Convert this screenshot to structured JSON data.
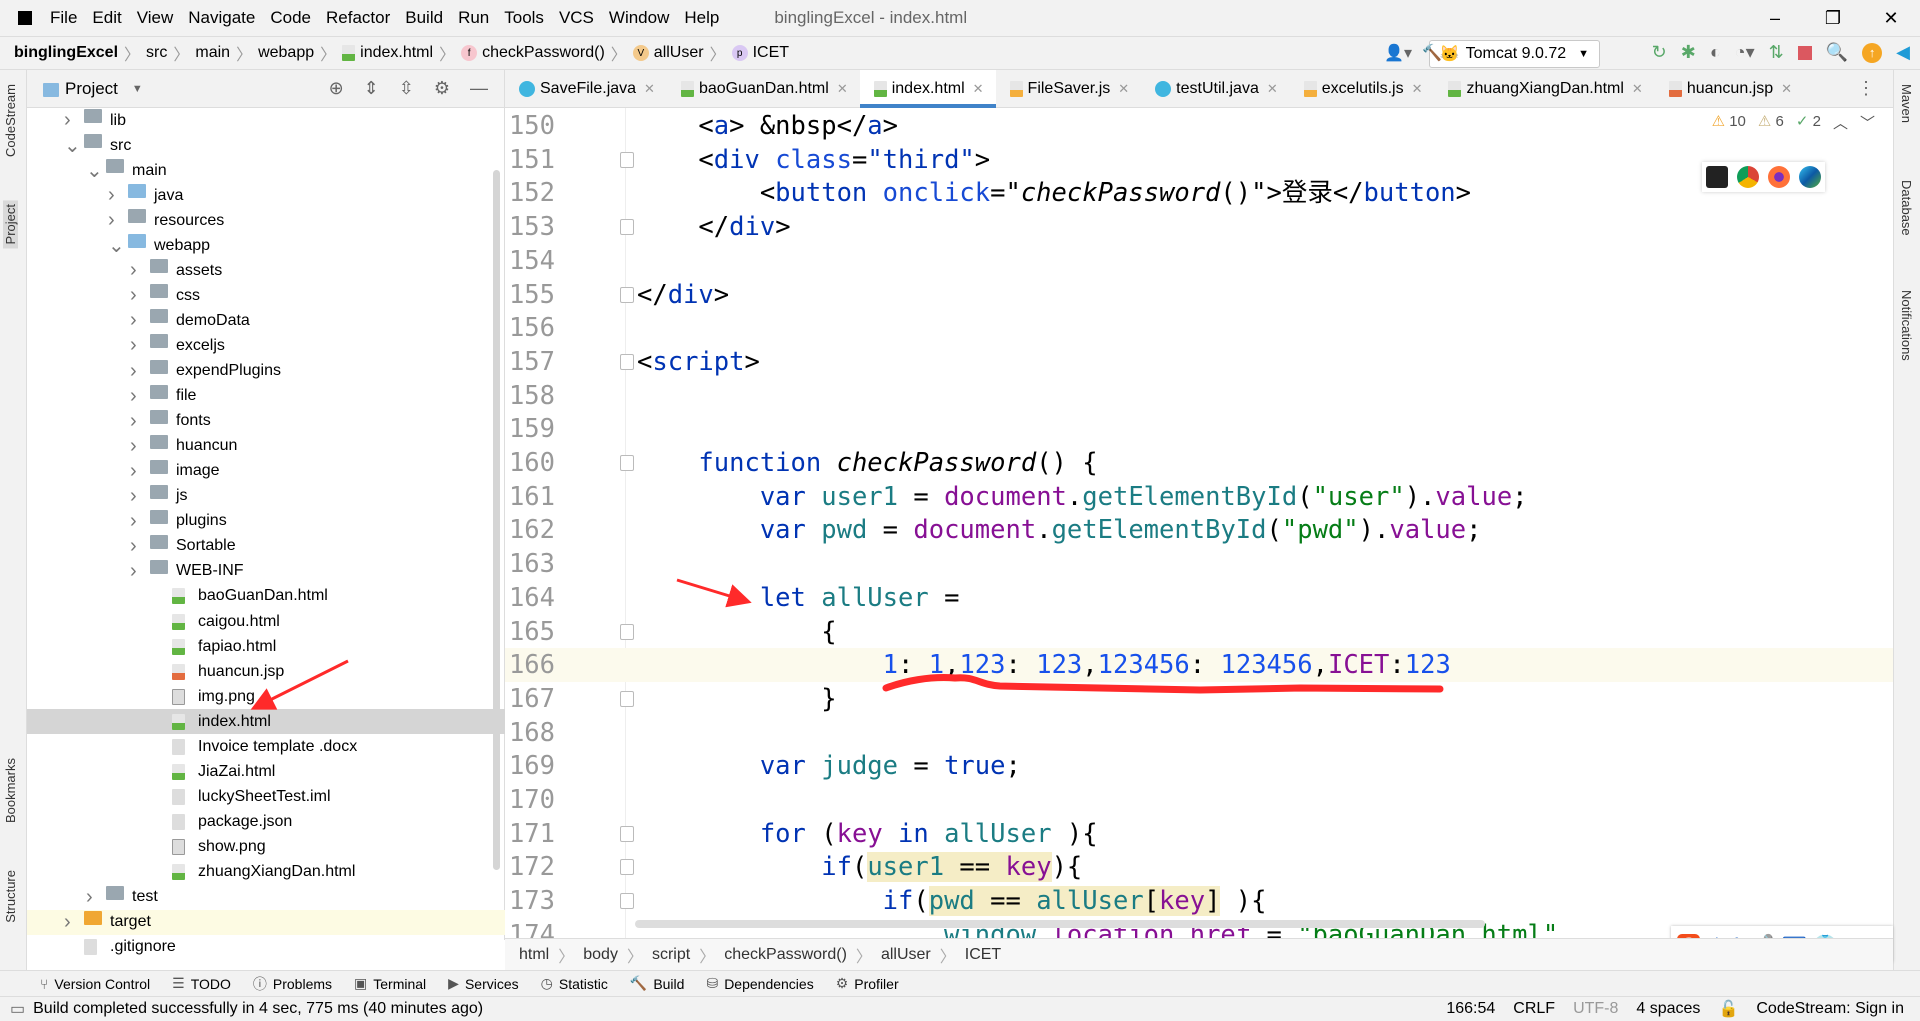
{
  "window": {
    "title": "binglingExcel - index.html",
    "controls": [
      "–",
      "❐",
      "✕"
    ]
  },
  "menu": [
    "File",
    "Edit",
    "View",
    "Navigate",
    "Code",
    "Refactor",
    "Build",
    "Run",
    "Tools",
    "VCS",
    "Window",
    "Help"
  ],
  "navbar": {
    "crumbs": [
      {
        "label": "binglingExcel",
        "icon": ""
      },
      {
        "label": "src",
        "icon": ""
      },
      {
        "label": "main",
        "icon": ""
      },
      {
        "label": "webapp",
        "icon": ""
      },
      {
        "label": "index.html",
        "icon": "html-file-icon"
      },
      {
        "label": "checkPassword()",
        "icon": "f"
      },
      {
        "label": "allUser",
        "icon": "V"
      },
      {
        "label": "ICET",
        "icon": "p"
      }
    ],
    "run_config": "Tomcat 9.0.72"
  },
  "project_panel": {
    "title": "Project",
    "tree": [
      {
        "label": "lib",
        "level": 1,
        "type": "folder",
        "arrow": "▶"
      },
      {
        "label": "src",
        "level": 1,
        "type": "folder",
        "arrow": "▼"
      },
      {
        "label": "main",
        "level": 2,
        "type": "folder",
        "arrow": "▼"
      },
      {
        "label": "java",
        "level": 3,
        "type": "folder-blue",
        "arrow": "▶"
      },
      {
        "label": "resources",
        "level": 3,
        "type": "folder",
        "arrow": "▶"
      },
      {
        "label": "webapp",
        "level": 3,
        "type": "folder-blue",
        "arrow": "▼"
      },
      {
        "label": "assets",
        "level": 4,
        "type": "folder",
        "arrow": "▶"
      },
      {
        "label": "css",
        "level": 4,
        "type": "folder",
        "arrow": "▶"
      },
      {
        "label": "demoData",
        "level": 4,
        "type": "folder",
        "arrow": "▶"
      },
      {
        "label": "exceljs",
        "level": 4,
        "type": "folder",
        "arrow": "▶"
      },
      {
        "label": "expendPlugins",
        "level": 4,
        "type": "folder",
        "arrow": "▶"
      },
      {
        "label": "file",
        "level": 4,
        "type": "folder",
        "arrow": "▶"
      },
      {
        "label": "fonts",
        "level": 4,
        "type": "folder",
        "arrow": "▶"
      },
      {
        "label": "huancun",
        "level": 4,
        "type": "folder",
        "arrow": "▶"
      },
      {
        "label": "image",
        "level": 4,
        "type": "folder",
        "arrow": "▶"
      },
      {
        "label": "js",
        "level": 4,
        "type": "folder",
        "arrow": "▶"
      },
      {
        "label": "plugins",
        "level": 4,
        "type": "folder",
        "arrow": "▶"
      },
      {
        "label": "Sortable",
        "level": 4,
        "type": "folder",
        "arrow": "▶"
      },
      {
        "label": "WEB-INF",
        "level": 4,
        "type": "folder",
        "arrow": "▶"
      },
      {
        "label": "baoGuanDan.html",
        "level": 5,
        "type": "h",
        "arrow": ""
      },
      {
        "label": "caigou.html",
        "level": 5,
        "type": "h",
        "arrow": ""
      },
      {
        "label": "fapiao.html",
        "level": 5,
        "type": "h",
        "arrow": ""
      },
      {
        "label": "huancun.jsp",
        "level": 5,
        "type": "jsp",
        "arrow": ""
      },
      {
        "label": "img.png",
        "level": 5,
        "type": "img",
        "arrow": ""
      },
      {
        "label": "index.html",
        "level": 5,
        "type": "h",
        "arrow": "",
        "selected": true
      },
      {
        "label": "Invoice template .docx",
        "level": 5,
        "type": "doc",
        "arrow": ""
      },
      {
        "label": "JiaZai.html",
        "level": 5,
        "type": "h",
        "arrow": ""
      },
      {
        "label": "luckySheetTest.iml",
        "level": 5,
        "type": "doc",
        "arrow": ""
      },
      {
        "label": "package.json",
        "level": 5,
        "type": "doc",
        "arrow": ""
      },
      {
        "label": "show.png",
        "level": 5,
        "type": "img",
        "arrow": ""
      },
      {
        "label": "zhuangXiangDan.html",
        "level": 5,
        "type": "h",
        "arrow": ""
      },
      {
        "label": "test",
        "level": 2,
        "type": "folder",
        "arrow": "▶"
      },
      {
        "label": "target",
        "level": 1,
        "type": "folder-orange",
        "arrow": "▶",
        "excluded": true
      },
      {
        "label": ".gitignore",
        "level": 1,
        "type": "doc",
        "arrow": ""
      }
    ]
  },
  "tabs": [
    {
      "label": "SaveFile.java",
      "icon": "c"
    },
    {
      "label": "baoGuanDan.html",
      "icon": "h"
    },
    {
      "label": "index.html",
      "icon": "h",
      "active": true
    },
    {
      "label": "FileSaver.js",
      "icon": "js"
    },
    {
      "label": "testUtil.java",
      "icon": "c"
    },
    {
      "label": "excelutils.js",
      "icon": "js"
    },
    {
      "label": "zhuangXiangDan.html",
      "icon": "h"
    },
    {
      "label": "huancun.jsp",
      "icon": "jsp"
    }
  ],
  "inspections": {
    "warnings": "10",
    "weak_warnings": "6",
    "typos": "2"
  },
  "editor": {
    "current_line": 166,
    "lines": [
      {
        "n": "150",
        "fold": false,
        "tokens": [
          [
            "p",
            "    <"
          ],
          [
            "tg",
            "a"
          ],
          [
            "p",
            "> &nbsp</"
          ],
          [
            "tg",
            "a"
          ],
          [
            "p",
            ">"
          ]
        ]
      },
      {
        "n": "151",
        "fold": true,
        "tokens": [
          [
            "p",
            "    <"
          ],
          [
            "tg",
            "div "
          ],
          [
            "at",
            "class"
          ],
          [
            "p",
            "="
          ],
          [
            "av",
            "\"third\""
          ],
          [
            "p",
            ">"
          ]
        ]
      },
      {
        "n": "152",
        "fold": false,
        "tokens": [
          [
            "p",
            "        <"
          ],
          [
            "tg",
            "button "
          ],
          [
            "at",
            "onclick"
          ],
          [
            "p",
            "=\""
          ],
          [
            "fn",
            "checkPassword"
          ],
          [
            "p",
            "()\">登录</"
          ],
          [
            "tg",
            "button"
          ],
          [
            "p",
            ">"
          ]
        ]
      },
      {
        "n": "153",
        "fold": true,
        "tokens": [
          [
            "p",
            "    </"
          ],
          [
            "tg",
            "div"
          ],
          [
            "p",
            ">"
          ]
        ]
      },
      {
        "n": "154",
        "fold": false,
        "tokens": []
      },
      {
        "n": "155",
        "fold": true,
        "tokens": [
          [
            "p",
            "</"
          ],
          [
            "tg",
            "div"
          ],
          [
            "p",
            ">"
          ]
        ]
      },
      {
        "n": "156",
        "fold": false,
        "tokens": []
      },
      {
        "n": "157",
        "fold": true,
        "tokens": [
          [
            "p",
            "<"
          ],
          [
            "tg",
            "script"
          ],
          [
            "p",
            ">"
          ]
        ]
      },
      {
        "n": "158",
        "fold": false,
        "tokens": []
      },
      {
        "n": "159",
        "fold": false,
        "tokens": []
      },
      {
        "n": "160",
        "fold": true,
        "tokens": [
          [
            "p",
            "    "
          ],
          [
            "k",
            "function "
          ],
          [
            "fn",
            "checkPassword"
          ],
          [
            "p",
            "() {"
          ]
        ]
      },
      {
        "n": "161",
        "fold": false,
        "tokens": [
          [
            "p",
            "        "
          ],
          [
            "k",
            "var "
          ],
          [
            "v",
            "user1"
          ],
          [
            "p",
            " = "
          ],
          [
            "g",
            "document"
          ],
          [
            "p",
            "."
          ],
          [
            "m",
            "getElementById"
          ],
          [
            "p",
            "("
          ],
          [
            "s",
            "\"user\""
          ],
          [
            "p",
            ")."
          ],
          [
            "pr",
            "value"
          ],
          [
            "p",
            ";"
          ]
        ]
      },
      {
        "n": "162",
        "fold": false,
        "tokens": [
          [
            "p",
            "        "
          ],
          [
            "k",
            "var "
          ],
          [
            "v",
            "pwd"
          ],
          [
            "p",
            " = "
          ],
          [
            "g",
            "document"
          ],
          [
            "p",
            "."
          ],
          [
            "m",
            "getElementById"
          ],
          [
            "p",
            "("
          ],
          [
            "s",
            "\"pwd\""
          ],
          [
            "p",
            ")."
          ],
          [
            "pr",
            "value"
          ],
          [
            "p",
            ";"
          ]
        ]
      },
      {
        "n": "163",
        "fold": false,
        "tokens": []
      },
      {
        "n": "164",
        "fold": false,
        "tokens": [
          [
            "p",
            "        "
          ],
          [
            "k",
            "let "
          ],
          [
            "v",
            "allUser"
          ],
          [
            "p",
            " ="
          ]
        ]
      },
      {
        "n": "165",
        "fold": true,
        "tokens": [
          [
            "p",
            "            {"
          ]
        ]
      },
      {
        "n": "166",
        "fold": false,
        "tokens": [
          [
            "p",
            "                "
          ],
          [
            "n",
            "1"
          ],
          [
            "p",
            ": "
          ],
          [
            "n",
            "1"
          ],
          [
            "p",
            ","
          ],
          [
            "n",
            "123"
          ],
          [
            "p",
            ": "
          ],
          [
            "n",
            "123"
          ],
          [
            "p",
            ","
          ],
          [
            "n",
            "123456"
          ],
          [
            "p",
            ": "
          ],
          [
            "n",
            "123456"
          ],
          [
            "p",
            ","
          ],
          [
            "pr",
            "ICET"
          ],
          [
            "p",
            ":"
          ],
          [
            "n",
            "123"
          ]
        ]
      },
      {
        "n": "167",
        "fold": true,
        "tokens": [
          [
            "p",
            "            }"
          ]
        ]
      },
      {
        "n": "168",
        "fold": false,
        "tokens": []
      },
      {
        "n": "169",
        "fold": false,
        "tokens": [
          [
            "p",
            "        "
          ],
          [
            "k",
            "var "
          ],
          [
            "v",
            "judge"
          ],
          [
            "p",
            " = "
          ],
          [
            "k",
            "true"
          ],
          [
            "p",
            ";"
          ]
        ]
      },
      {
        "n": "170",
        "fold": false,
        "tokens": []
      },
      {
        "n": "171",
        "fold": true,
        "tokens": [
          [
            "p",
            "        "
          ],
          [
            "k",
            "for "
          ],
          [
            "p",
            "("
          ],
          [
            "pr",
            "key"
          ],
          [
            "p",
            " "
          ],
          [
            "k",
            "in "
          ],
          [
            "v",
            "allUser"
          ],
          [
            "p",
            " ){"
          ]
        ]
      },
      {
        "n": "172",
        "fold": true,
        "tokens": [
          [
            "p",
            "            "
          ],
          [
            "k",
            "if"
          ],
          [
            "p",
            "("
          ],
          [
            "v hl",
            "user1"
          ],
          [
            "p hl",
            " == "
          ],
          [
            "pr hl",
            "key"
          ],
          [
            "p",
            ")"
          ],
          [
            "p",
            "{"
          ]
        ]
      },
      {
        "n": "173",
        "fold": true,
        "tokens": [
          [
            "p",
            "                "
          ],
          [
            "k",
            "if"
          ],
          [
            "p",
            "("
          ],
          [
            "v hl",
            "pwd"
          ],
          [
            "p hl",
            " == "
          ],
          [
            "v hl",
            "allUser"
          ],
          [
            "p hl",
            "["
          ],
          [
            "pr hl",
            "key"
          ],
          [
            "p hl",
            "]"
          ],
          [
            "p",
            " ){"
          ]
        ]
      },
      {
        "n": "174",
        "fold": false,
        "tokens": [
          [
            "p",
            "                    "
          ],
          [
            "v",
            "window"
          ],
          [
            "p",
            "."
          ],
          [
            "pr",
            "location"
          ],
          [
            "p",
            "."
          ],
          [
            "pr",
            "href"
          ],
          [
            "p",
            " = "
          ],
          [
            "s",
            "\"baoGuanDan.html\""
          ]
        ]
      }
    ]
  },
  "breadcrumb": [
    "html",
    "body",
    "script",
    "checkPassword()",
    "allUser",
    "ICET"
  ],
  "tool_windows": [
    "Version Control",
    "TODO",
    "Problems",
    "Terminal",
    "Services",
    "Statistic",
    "Build",
    "Dependencies",
    "Profiler"
  ],
  "left_stripe": [
    "CodeStream",
    "Project",
    "Bookmarks",
    "Structure"
  ],
  "right_stripe": [
    "Maven",
    "Database",
    "Notifications"
  ],
  "status": {
    "message": "Build completed successfully in 4 sec, 775 ms (40 minutes ago)",
    "position": "166:54",
    "line_sep": "CRLF",
    "encoding": "UTF-8",
    "indent": "4 spaces",
    "codestream": "CodeStream: Sign in"
  },
  "ime": {
    "mode": "中"
  },
  "annotation_color": "#ff2a2a"
}
